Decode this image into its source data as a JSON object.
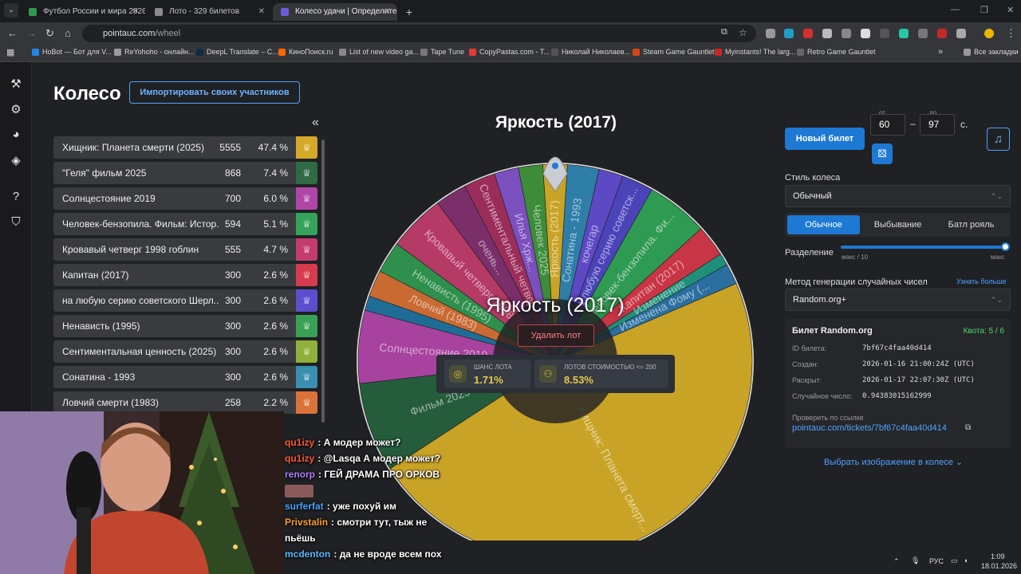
{
  "browser": {
    "tabs": [
      {
        "title": "Футбол России и мира 2026 -",
        "color": "#2e9a4d"
      },
      {
        "title": "Лото - 329 билетов",
        "color": "#8a8a8a"
      },
      {
        "title": "Колесо удачи | Определите по",
        "color": "#6b5bd6"
      }
    ],
    "tab_close": "✕",
    "new_tab": "+",
    "url_domain": "pointauc.com",
    "url_path": "/wheel",
    "bookmarks": [
      {
        "label": "HoBot — Бот для V...",
        "color": "#1e88e5"
      },
      {
        "label": "ReYohoho - онлайн...",
        "color": "#9a9a9a"
      },
      {
        "label": "DeepL Translate – С...",
        "color": "#0f2b46"
      },
      {
        "label": "КиноПоиск.ru",
        "color": "#ff6600"
      },
      {
        "label": "List of new video ga...",
        "color": "#888"
      },
      {
        "label": "Tape Tune",
        "color": "#777"
      },
      {
        "label": "CopyPastas.com - T...",
        "color": "#e53935"
      },
      {
        "label": "Николай Николаев...",
        "color": "#555"
      },
      {
        "label": "Steam Game Gauntlet",
        "color": "#d84315"
      },
      {
        "label": "Myinstants! The larg...",
        "color": "#c62828"
      },
      {
        "label": "Retro Game Gauntlet",
        "color": "#666"
      }
    ],
    "all_bookmarks": "Все закладки"
  },
  "page": {
    "title": "Колесо",
    "import_button": "Импортировать своих участников",
    "collapse": "«"
  },
  "lots": [
    {
      "name": "Хищник: Планета смерти (2025)",
      "amount": "5555",
      "percent": "47.4 %",
      "color": "#d4a828"
    },
    {
      "name": "\"Геля\" фильм 2025",
      "amount": "868",
      "percent": "7.4 %",
      "color": "#2f6b44"
    },
    {
      "name": "Солнцестояние 2019",
      "amount": "700",
      "percent": "6.0 %",
      "color": "#b046a8"
    },
    {
      "name": "Человек-бензопила. Фильм: Истор...",
      "amount": "594",
      "percent": "5.1 %",
      "color": "#35a35a"
    },
    {
      "name": "Кровавый четверг 1998 гоблин",
      "amount": "555",
      "percent": "4.7 %",
      "color": "#c43c6e"
    },
    {
      "name": "Капитан (2017)",
      "amount": "300",
      "percent": "2.6 %",
      "color": "#d63c4e"
    },
    {
      "name": "на любую серию советского Шерл...",
      "amount": "300",
      "percent": "2.6 %",
      "color": "#5b4fd0"
    },
    {
      "name": "Ненависть (1995)",
      "amount": "300",
      "percent": "2.6 %",
      "color": "#3aa055"
    },
    {
      "name": "Сентиментальная ценность (2025)",
      "amount": "300",
      "percent": "2.6 %",
      "color": "#8fb03a"
    },
    {
      "name": "Сонатина - 1993",
      "amount": "300",
      "percent": "2.6 %",
      "color": "#3a8fb0"
    },
    {
      "name": "Ловчий смерти (1983)",
      "amount": "258",
      "percent": "2.2 %",
      "color": "#d9733a"
    }
  ],
  "wheel": {
    "winner": "Яркость (2017)",
    "delete_button": "Удалить лот",
    "segments": [
      {
        "label": "Хищник: Планета смерт...",
        "color": "#c9a326",
        "share": 47.4
      },
      {
        "label": "Фильм 2025",
        "color": "#255c3c",
        "share": 7.4
      },
      {
        "label": "Солнцестояние 2019",
        "color": "#a7429f",
        "share": 6.0
      },
      {
        "label": "",
        "color": "#1f6d96",
        "share": 1.2
      },
      {
        "label": "Ловчий (1983)",
        "color": "#c96a33",
        "share": 2.2
      },
      {
        "label": "Ненависть (1995)",
        "color": "#2f8f4c",
        "share": 2.6
      },
      {
        "label": "Кровавый четверг 1998",
        "color": "#b53a66",
        "share": 4.7
      },
      {
        "label": "очень...",
        "color": "#7a2f6b",
        "share": 2.6
      },
      {
        "label": "Сентиментальный четверг",
        "color": "#9b2d5a",
        "share": 2.6
      },
      {
        "label": "Илья Хрж...",
        "color": "#7c4fbf",
        "share": 2.0
      },
      {
        "label": "Человек 2025",
        "color": "#3d8c3a",
        "share": 2.0
      },
      {
        "label": "Яркость (2017)",
        "color": "#c9a326",
        "share": 2.0
      },
      {
        "label": "Сонатина - 1993",
        "color": "#2e7ea8",
        "share": 2.6
      },
      {
        "label": "кочегар",
        "color": "#5d49c4",
        "share": 2.0
      },
      {
        "label": "на любую серию советск...",
        "color": "#4b43b8",
        "share": 2.6
      },
      {
        "label": "Человек-бензопила. Фи...",
        "color": "#2f9a52",
        "share": 5.1
      },
      {
        "label": "Капитан (2017)",
        "color": "#c83545",
        "share": 2.6
      },
      {
        "label": "Изменение",
        "color": "#1f8f7a",
        "share": 1.0
      },
      {
        "label": "Изменена Фому (...",
        "color": "#2b6fa0",
        "share": 1.7
      }
    ]
  },
  "stats": {
    "chance_label": "ШАНС ЛОТА",
    "chance_value": "1.71%",
    "count_label": "ЛОТОВ СТОИМОСТЬЮ <= 200",
    "count_value": "8.53%"
  },
  "settings": {
    "new_ticket": "Новый билет",
    "from_label": "от",
    "from_value": "60",
    "to_label": "до",
    "to_value": "97",
    "dash": "–",
    "unit": "с.",
    "style_label": "Стиль колеса",
    "style_value": "Обычный",
    "modes": [
      "Обычное",
      "Выбывание",
      "Батл рояль"
    ],
    "split_label": "Разделение",
    "split_min": "макс / 10",
    "split_max": "макс",
    "split_level": 1.0,
    "rng_label": "Метод генерации случайных чисел",
    "learn_more": "Узнать больше",
    "rng_value": "Random.org+",
    "select_arrow": "⌃⌄",
    "ticket": {
      "title": "Билет Random.org",
      "quota": "Квота: 5 / 6",
      "rows": [
        {
          "k": "ID билета:",
          "v": "7bf67c4faa40d414"
        },
        {
          "k": "Создан:",
          "v": "2026-01-16 21:00:24Z (UTC)"
        },
        {
          "k": "Раскрыт:",
          "v": "2026-01-17 22:07:30Z (UTC)"
        },
        {
          "k": "Случайное число:",
          "v": "0.94383015162999"
        }
      ],
      "verify_label": "Проверить по ссылке",
      "link": "pointauc.com/tickets/7bf67c4faa40d414"
    },
    "choose_image": "Выбрать изображение в колесе"
  },
  "chat": [
    {
      "user": "qu1izy",
      "sep": ":",
      "text": "А модер может?",
      "color": "#ff5a36"
    },
    {
      "user": "qu1izy",
      "sep": ":",
      "text": "@Lasqa А модер может?",
      "color": "#ff5a36",
      "mention": "@Lasqa"
    },
    {
      "user": "renorp",
      "sep": ":",
      "text": "ГЕЙ ДРАМА ПРО ОРКОВ",
      "color": "#b07cff"
    },
    {
      "user": "",
      "sep": "",
      "text": "",
      "color": "#fff"
    },
    {
      "user": "surferfat",
      "sep": ":",
      "text": "уже похуй им",
      "color": "#4da3ff"
    },
    {
      "user": "Privstalin",
      "sep": ":",
      "text": "смотри тут, тыж не",
      "color": "#ff9d2e"
    },
    {
      "user": "",
      "sep": "",
      "text": "пьёшь",
      "color": "#fff"
    },
    {
      "user": "mcdenton",
      "sep": ":",
      "text": "да не вроде всем пох",
      "color": "#5bb8ff"
    }
  ],
  "taskbar": {
    "lang": "РУС",
    "time": "1:09",
    "date": "18.01.2026"
  }
}
